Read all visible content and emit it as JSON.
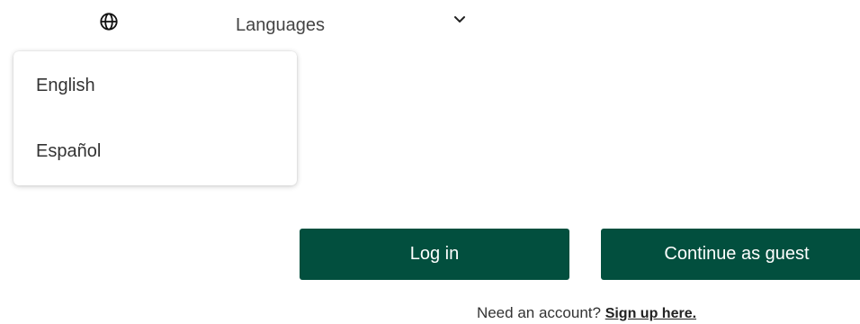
{
  "language_selector": {
    "label": "Languages",
    "icon": "globe-icon",
    "toggle_icon": "chevron-down-icon"
  },
  "language_menu": {
    "options": [
      {
        "label": "English"
      },
      {
        "label": "Español"
      }
    ]
  },
  "actions": {
    "login_label": "Log in",
    "guest_label": "Continue as guest"
  },
  "signup": {
    "prompt": "Need an account?",
    "link_label": "Sign up here."
  },
  "colors": {
    "primary_button": "#024f3e",
    "button_text": "#ffffff"
  }
}
